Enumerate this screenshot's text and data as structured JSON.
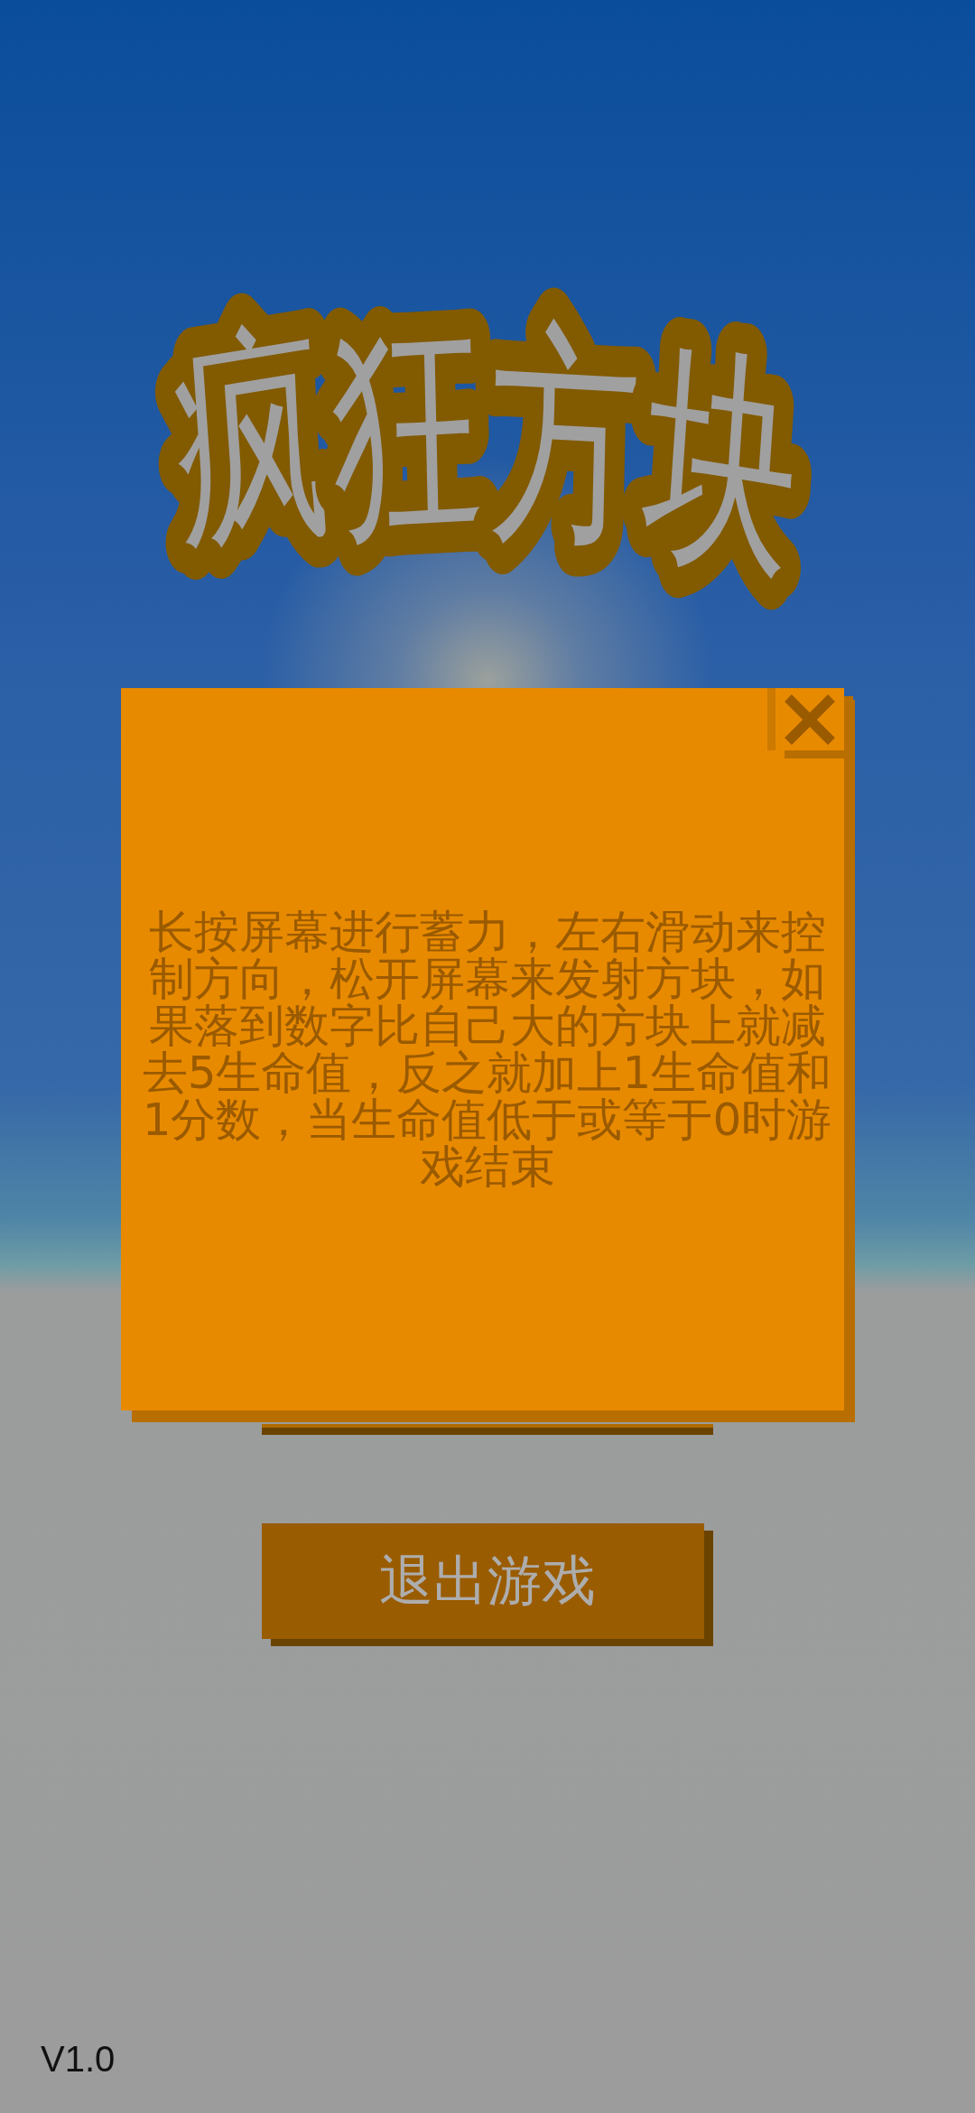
{
  "title": "疯狂方块",
  "dialog": {
    "message": "长按屏幕进行蓄力，左右滑动来控制方向，松开屏幕来发射方块，如果落到数字比自己大的方块上就减去5生命值，反之就加上1生命值和1分数，当生命值低于或等于0时游戏结束"
  },
  "exit_button": {
    "label": "退出游戏"
  },
  "version": "V1.0"
}
